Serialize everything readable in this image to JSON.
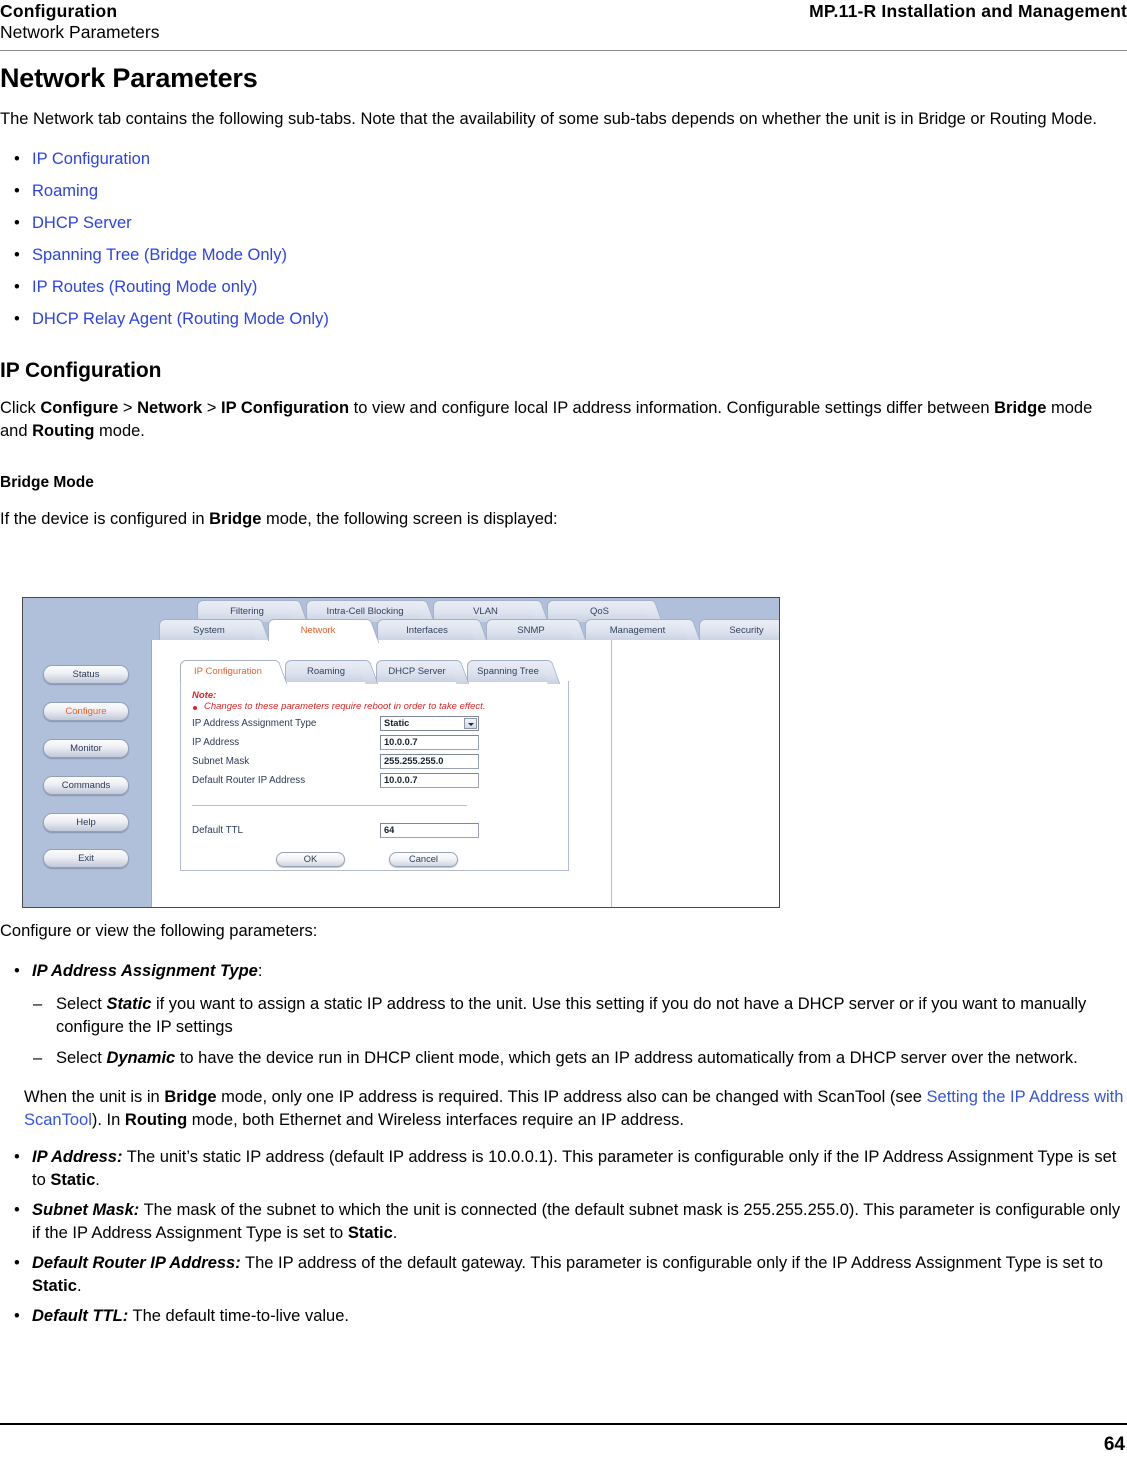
{
  "header": {
    "left_title": "Configuration",
    "left_subtitle": "Network Parameters",
    "right_title": "MP.11-R Installation and Management"
  },
  "footer": {
    "page_number": "64"
  },
  "main": {
    "h1": "Network Parameters",
    "intro": "The Network tab contains the following sub-tabs. Note that the availability of some sub-tabs depends on whether the unit is in Bridge or Routing Mode.",
    "subtab_links": [
      "IP Configuration",
      "Roaming",
      "DHCP Server",
      "Spanning Tree (Bridge Mode Only)",
      "IP Routes (Routing Mode only)",
      "DHCP Relay Agent (Routing Mode Only)"
    ],
    "h2_ip_configuration": "IP Configuration",
    "ip_config_para": {
      "p1": "Click ",
      "b1": "Configure",
      "sep1": " > ",
      "b2": "Network",
      "sep2": " > ",
      "b3": "IP Configuration",
      "p2": " to view and configure local IP address information. Configurable settings differ between ",
      "b4": "Bridge",
      "p3": " mode and ",
      "b5": "Routing",
      "p4": " mode."
    },
    "h3_bridge_mode": "Bridge Mode",
    "bridge_mode_para": {
      "p1": "If the device is configured in ",
      "b1": "Bridge",
      "p2": " mode, the following screen is displayed:"
    },
    "configure_or_view": "Configure or view the following parameters:",
    "param_assignment_type": {
      "bold": "IP Address Assignment Type",
      "tail": ":"
    },
    "dash_items": [
      {
        "p1": "Select ",
        "bi": "Static",
        "p2": " if you want to assign a static IP address to the unit. Use this setting if you do not have a DHCP server or if you want to manually configure the IP settings"
      },
      {
        "p1": "Select ",
        "bi": "Dynamic",
        "p2": " to have the device run in DHCP client mode, which gets an IP address automatically from a DHCP server over the network."
      }
    ],
    "bridge_note": {
      "p1": "When the unit is in ",
      "b1": "Bridge",
      "p2": " mode, only one IP address is required. This IP address also can be changed with ScanTool (see ",
      "link": "Setting the IP Address with ScanTool",
      "p3": "). In ",
      "b2": "Routing",
      "p4": " mode, both Ethernet and Wireless interfaces require an IP address."
    },
    "param_bullets": [
      {
        "bold": "IP Address:",
        "t1": " The unit’s static IP address (default IP address is 10.0.0.1). This parameter is configurable only if the IP Address Assignment Type is set to ",
        "b2": "Static",
        "t2": "."
      },
      {
        "bold": "Subnet Mask:",
        "t1": " The mask of the subnet to which the unit is connected (the default subnet mask is 255.255.255.0). This parameter is configurable only if the IP Address Assignment Type is set to ",
        "b2": "Static",
        "t2": "."
      },
      {
        "bold": "Default Router IP Address:",
        "t1": " The IP address of the default gateway. This parameter is configurable only if the IP Address Assignment Type is set to ",
        "b2": "Static",
        "t2": "."
      },
      {
        "bold": "Default TTL:",
        "t1": " The default time-to-live value.",
        "b2": "",
        "t2": ""
      }
    ]
  },
  "screenshot": {
    "nav_buttons": [
      {
        "label": "Status",
        "selected": false
      },
      {
        "label": "Configure",
        "selected": true
      },
      {
        "label": "Monitor",
        "selected": false
      },
      {
        "label": "Commands",
        "selected": false
      },
      {
        "label": "Help",
        "selected": false
      },
      {
        "label": "Exit",
        "selected": false
      }
    ],
    "upper_tabs": [
      {
        "label": "Filtering",
        "active": false
      },
      {
        "label": "Intra-Cell Blocking",
        "active": false
      },
      {
        "label": "VLAN",
        "active": false
      },
      {
        "label": "QoS",
        "active": false
      }
    ],
    "main_tabs": [
      {
        "label": "System",
        "active": false
      },
      {
        "label": "Network",
        "active": true
      },
      {
        "label": "Interfaces",
        "active": false
      },
      {
        "label": "SNMP",
        "active": false
      },
      {
        "label": "Management",
        "active": false
      },
      {
        "label": "Security",
        "active": false
      }
    ],
    "sub_tabs": [
      {
        "label": "IP Configuration",
        "active": true
      },
      {
        "label": "Roaming",
        "active": false
      },
      {
        "label": "DHCP Server",
        "active": false
      },
      {
        "label": "Spanning Tree",
        "active": false
      }
    ],
    "note_title": "Note:",
    "note_text": "Changes to these parameters require reboot in order to take effect.",
    "fields": [
      {
        "label": "IP Address Assignment Type",
        "value": "Static",
        "type": "select"
      },
      {
        "label": "IP Address",
        "value": "10.0.0.7",
        "type": "text"
      },
      {
        "label": "Subnet Mask",
        "value": "255.255.255.0",
        "type": "text"
      },
      {
        "label": "Default Router IP Address",
        "value": "10.0.0.7",
        "type": "text"
      },
      {
        "label": "Default TTL",
        "value": "64",
        "type": "text"
      }
    ],
    "buttons": {
      "ok": "OK",
      "cancel": "Cancel"
    },
    "colors": {
      "sidebar": "#b0c0da",
      "accent": "#e8622a",
      "note": "#dc2626",
      "tab_text": "#31415f"
    }
  }
}
